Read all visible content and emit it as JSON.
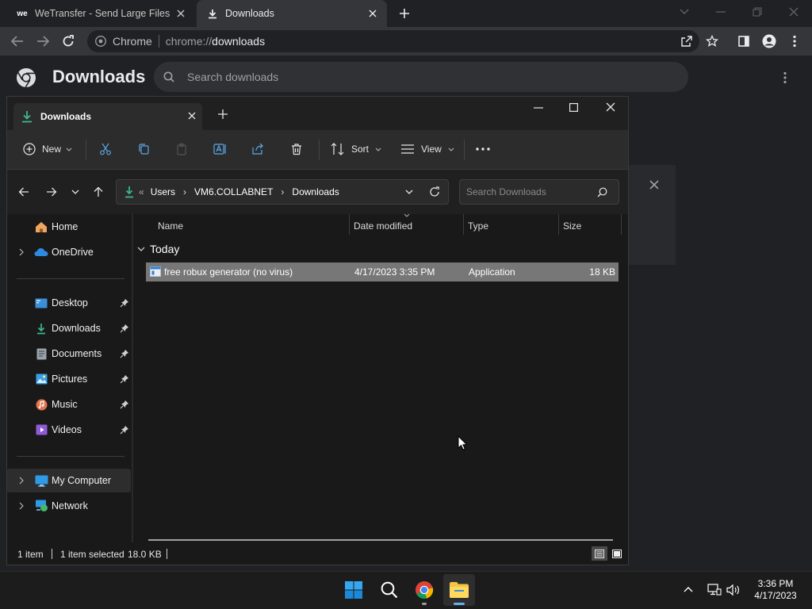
{
  "chrome": {
    "tabs": [
      {
        "title": "WeTransfer - Send Large Files & Share Photos Online",
        "favicon": "we-logo"
      },
      {
        "title": "Downloads",
        "favicon": "download-icon"
      }
    ],
    "omnibox": {
      "site": "Chrome",
      "url_prefix": "chrome://",
      "url_host": "downloads"
    },
    "page_title": "Downloads",
    "search_placeholder": "Search downloads"
  },
  "explorer": {
    "tab_title": "Downloads",
    "commands": {
      "new": "New",
      "sort": "Sort",
      "view": "View"
    },
    "breadcrumb": [
      "Users",
      "VM6.COLLABNET",
      "Downloads"
    ],
    "search_placeholder": "Search Downloads",
    "nav": {
      "home": "Home",
      "onedrive": "OneDrive",
      "pinned": [
        "Desktop",
        "Downloads",
        "Documents",
        "Pictures",
        "Music",
        "Videos"
      ],
      "my_computer": "My Computer",
      "network": "Network"
    },
    "columns": [
      "Name",
      "Date modified",
      "Type",
      "Size"
    ],
    "group": "Today",
    "files": [
      {
        "name": "free robux generator (no virus)",
        "date": "4/17/2023 3:35 PM",
        "type": "Application",
        "size": "18 KB"
      }
    ],
    "status": {
      "count": "1 item",
      "selected": "1 item selected",
      "size": "18.0 KB"
    }
  },
  "taskbar": {
    "time": "3:36 PM",
    "date": "4/17/2023"
  },
  "colors": {
    "accent": "#0078d4",
    "selection": "#777777",
    "chrome_dark": "#202124"
  }
}
